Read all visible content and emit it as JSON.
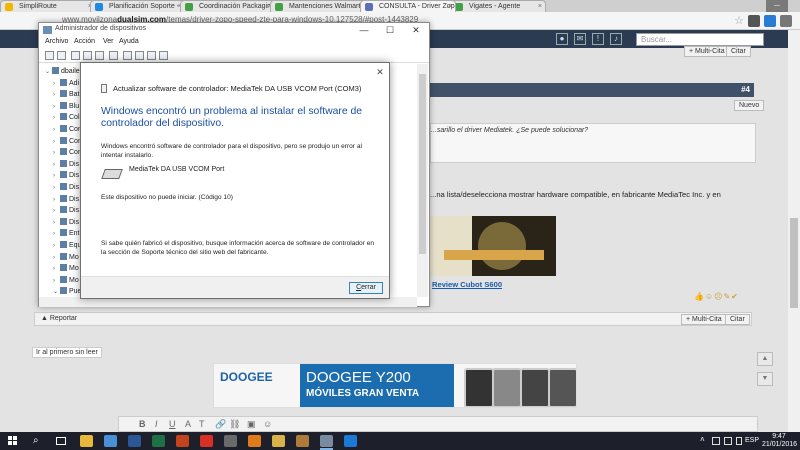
{
  "browser": {
    "tabs": [
      {
        "label": "SimpliRoute",
        "color": "#f4b400"
      },
      {
        "label": "Planificación Soporte - Fr",
        "color": "#1e88e5"
      },
      {
        "label": "Coordinación Packaging",
        "color": "#43a047"
      },
      {
        "label": "Mantenciones Walmart D",
        "color": "#43a047"
      },
      {
        "label": "CONSULTA - Driver Zopo",
        "color": "#5d6fb5"
      },
      {
        "label": "Vigates - Agente",
        "color": "#43a047"
      }
    ],
    "url_prefix": "www.movilzona",
    "url_domain": "dualsim.com",
    "url_rest": "/temas/driver-zopo-speed-zte-para-windows-10.127528/#post-1443829"
  },
  "forum": {
    "search_placeholder": "Buscar...",
    "multi_cita": "+ Multi-Cita",
    "citar": "Citar",
    "post_number": "#4",
    "new_badge": "Nuevo",
    "quote": "...sarillo el driver Mediatek. ¿Se puede solucionar?",
    "post_text": "...na lista/deselecciona mostrar hardware compatible, en fabricante MediaTec Inc. y en",
    "review_link": "Review Cubot S600",
    "report": "Reportar",
    "first_unread": "Ir al primero sin leer",
    "ad": {
      "brand": "DOOGEE",
      "title": "DOOGEE Y200",
      "subtitle": "MÓVILES GRAN VENTA"
    }
  },
  "device_manager": {
    "title": "Administrador de dispositivos",
    "menu": [
      "Archivo",
      "Acción",
      "Ver",
      "Ayuda"
    ],
    "tree": [
      {
        "label": "dbaile",
        "expand": "⌄"
      },
      {
        "label": "Adi",
        "expand": "›"
      },
      {
        "label": "Bat",
        "expand": "›"
      },
      {
        "label": "Blu",
        "expand": "›"
      },
      {
        "label": "Col",
        "expand": "›"
      },
      {
        "label": "Con",
        "expand": "›"
      },
      {
        "label": "Con",
        "expand": "›"
      },
      {
        "label": "Con",
        "expand": "›"
      },
      {
        "label": "Dis",
        "expand": "›"
      },
      {
        "label": "Dis",
        "expand": "›"
      },
      {
        "label": "Dis",
        "expand": "›"
      },
      {
        "label": "Dis",
        "expand": "›"
      },
      {
        "label": "Dis",
        "expand": "›"
      },
      {
        "label": "Dis",
        "expand": "›"
      },
      {
        "label": "Ent",
        "expand": "›"
      },
      {
        "label": "Equ",
        "expand": "›"
      },
      {
        "label": "Mo",
        "expand": "›"
      },
      {
        "label": "Mo",
        "expand": "›"
      },
      {
        "label": "Mo",
        "expand": "›"
      },
      {
        "label": "Pue",
        "expand": "⌄"
      }
    ]
  },
  "dialog": {
    "header": "Actualizar software de controlador: MediaTek DA USB VCOM Port (COM3)",
    "heading": "Windows encontró un problema al instalar el software de controlador del dispositivo.",
    "description": "Windows encontró software de controlador para el dispositivo, pero se produjo un error al intentar instalarlo.",
    "device_name": "MediaTek DA USB VCOM Port",
    "error": "Este dispositivo no puede iniciar. (Código 10)",
    "help": "Si sabe quién fabricó el dispositivo, busque información acerca de software de controlador en la sección de Soporte técnico del sitio web del fabricante.",
    "close_label_underlined": "C",
    "close_label_rest": "errar"
  },
  "taskbar": {
    "lang": "ESP",
    "time": "9:47",
    "date": "21/01/2016",
    "apps": [
      {
        "name": "file-explorer",
        "color": "#e8b83a"
      },
      {
        "name": "store",
        "color": "#4a90d9"
      },
      {
        "name": "word",
        "color": "#2b5797"
      },
      {
        "name": "excel",
        "color": "#1e7145"
      },
      {
        "name": "powerpoint",
        "color": "#c1441c"
      },
      {
        "name": "chrome",
        "color": "#d93025"
      },
      {
        "name": "calculator",
        "color": "#6a6a6a"
      },
      {
        "name": "app-orange",
        "color": "#e07b1a"
      },
      {
        "name": "app-yellow",
        "color": "#d9b34a"
      },
      {
        "name": "app-boxes",
        "color": "#b07b3a"
      },
      {
        "name": "device-manager",
        "color": "#7a8aa0"
      },
      {
        "name": "edge",
        "color": "#1c79d6"
      }
    ]
  }
}
